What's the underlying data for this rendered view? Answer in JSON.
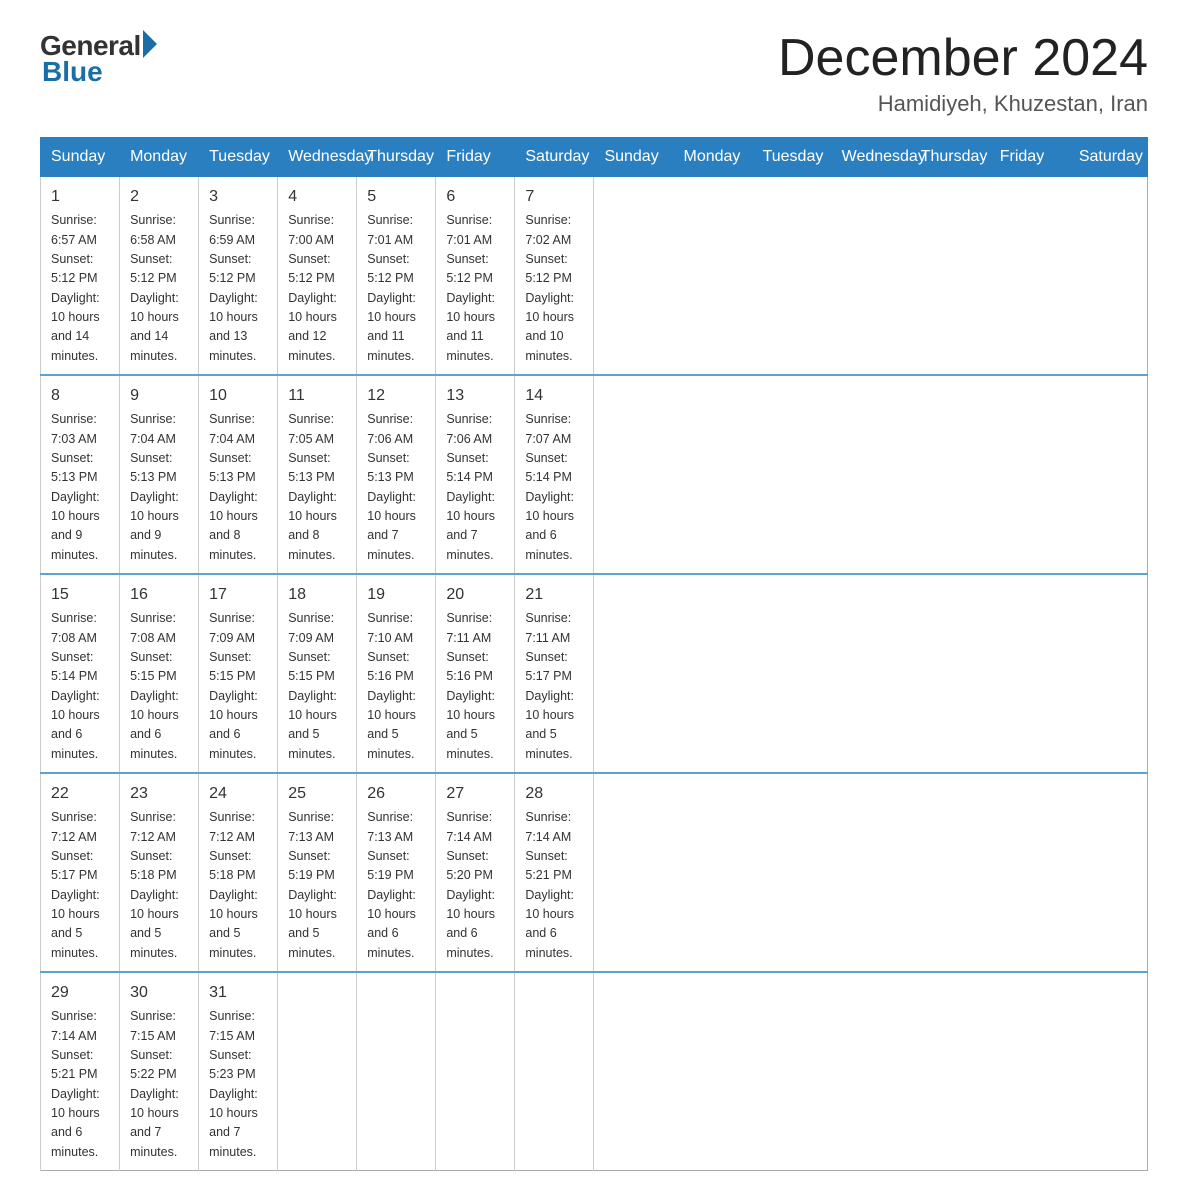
{
  "header": {
    "logo_general": "General",
    "logo_blue": "Blue",
    "month_title": "December 2024",
    "location": "Hamidiyeh, Khuzestan, Iran"
  },
  "days_of_week": [
    "Sunday",
    "Monday",
    "Tuesday",
    "Wednesday",
    "Thursday",
    "Friday",
    "Saturday"
  ],
  "weeks": [
    [
      {
        "day": "1",
        "sunrise": "6:57 AM",
        "sunset": "5:12 PM",
        "daylight": "10 hours and 14 minutes."
      },
      {
        "day": "2",
        "sunrise": "6:58 AM",
        "sunset": "5:12 PM",
        "daylight": "10 hours and 14 minutes."
      },
      {
        "day": "3",
        "sunrise": "6:59 AM",
        "sunset": "5:12 PM",
        "daylight": "10 hours and 13 minutes."
      },
      {
        "day": "4",
        "sunrise": "7:00 AM",
        "sunset": "5:12 PM",
        "daylight": "10 hours and 12 minutes."
      },
      {
        "day": "5",
        "sunrise": "7:01 AM",
        "sunset": "5:12 PM",
        "daylight": "10 hours and 11 minutes."
      },
      {
        "day": "6",
        "sunrise": "7:01 AM",
        "sunset": "5:12 PM",
        "daylight": "10 hours and 11 minutes."
      },
      {
        "day": "7",
        "sunrise": "7:02 AM",
        "sunset": "5:12 PM",
        "daylight": "10 hours and 10 minutes."
      }
    ],
    [
      {
        "day": "8",
        "sunrise": "7:03 AM",
        "sunset": "5:13 PM",
        "daylight": "10 hours and 9 minutes."
      },
      {
        "day": "9",
        "sunrise": "7:04 AM",
        "sunset": "5:13 PM",
        "daylight": "10 hours and 9 minutes."
      },
      {
        "day": "10",
        "sunrise": "7:04 AM",
        "sunset": "5:13 PM",
        "daylight": "10 hours and 8 minutes."
      },
      {
        "day": "11",
        "sunrise": "7:05 AM",
        "sunset": "5:13 PM",
        "daylight": "10 hours and 8 minutes."
      },
      {
        "day": "12",
        "sunrise": "7:06 AM",
        "sunset": "5:13 PM",
        "daylight": "10 hours and 7 minutes."
      },
      {
        "day": "13",
        "sunrise": "7:06 AM",
        "sunset": "5:14 PM",
        "daylight": "10 hours and 7 minutes."
      },
      {
        "day": "14",
        "sunrise": "7:07 AM",
        "sunset": "5:14 PM",
        "daylight": "10 hours and 6 minutes."
      }
    ],
    [
      {
        "day": "15",
        "sunrise": "7:08 AM",
        "sunset": "5:14 PM",
        "daylight": "10 hours and 6 minutes."
      },
      {
        "day": "16",
        "sunrise": "7:08 AM",
        "sunset": "5:15 PM",
        "daylight": "10 hours and 6 minutes."
      },
      {
        "day": "17",
        "sunrise": "7:09 AM",
        "sunset": "5:15 PM",
        "daylight": "10 hours and 6 minutes."
      },
      {
        "day": "18",
        "sunrise": "7:09 AM",
        "sunset": "5:15 PM",
        "daylight": "10 hours and 5 minutes."
      },
      {
        "day": "19",
        "sunrise": "7:10 AM",
        "sunset": "5:16 PM",
        "daylight": "10 hours and 5 minutes."
      },
      {
        "day": "20",
        "sunrise": "7:11 AM",
        "sunset": "5:16 PM",
        "daylight": "10 hours and 5 minutes."
      },
      {
        "day": "21",
        "sunrise": "7:11 AM",
        "sunset": "5:17 PM",
        "daylight": "10 hours and 5 minutes."
      }
    ],
    [
      {
        "day": "22",
        "sunrise": "7:12 AM",
        "sunset": "5:17 PM",
        "daylight": "10 hours and 5 minutes."
      },
      {
        "day": "23",
        "sunrise": "7:12 AM",
        "sunset": "5:18 PM",
        "daylight": "10 hours and 5 minutes."
      },
      {
        "day": "24",
        "sunrise": "7:12 AM",
        "sunset": "5:18 PM",
        "daylight": "10 hours and 5 minutes."
      },
      {
        "day": "25",
        "sunrise": "7:13 AM",
        "sunset": "5:19 PM",
        "daylight": "10 hours and 5 minutes."
      },
      {
        "day": "26",
        "sunrise": "7:13 AM",
        "sunset": "5:19 PM",
        "daylight": "10 hours and 6 minutes."
      },
      {
        "day": "27",
        "sunrise": "7:14 AM",
        "sunset": "5:20 PM",
        "daylight": "10 hours and 6 minutes."
      },
      {
        "day": "28",
        "sunrise": "7:14 AM",
        "sunset": "5:21 PM",
        "daylight": "10 hours and 6 minutes."
      }
    ],
    [
      {
        "day": "29",
        "sunrise": "7:14 AM",
        "sunset": "5:21 PM",
        "daylight": "10 hours and 6 minutes."
      },
      {
        "day": "30",
        "sunrise": "7:15 AM",
        "sunset": "5:22 PM",
        "daylight": "10 hours and 7 minutes."
      },
      {
        "day": "31",
        "sunrise": "7:15 AM",
        "sunset": "5:23 PM",
        "daylight": "10 hours and 7 minutes."
      },
      null,
      null,
      null,
      null
    ]
  ],
  "labels": {
    "sunrise": "Sunrise:",
    "sunset": "Sunset:",
    "daylight": "Daylight:"
  }
}
